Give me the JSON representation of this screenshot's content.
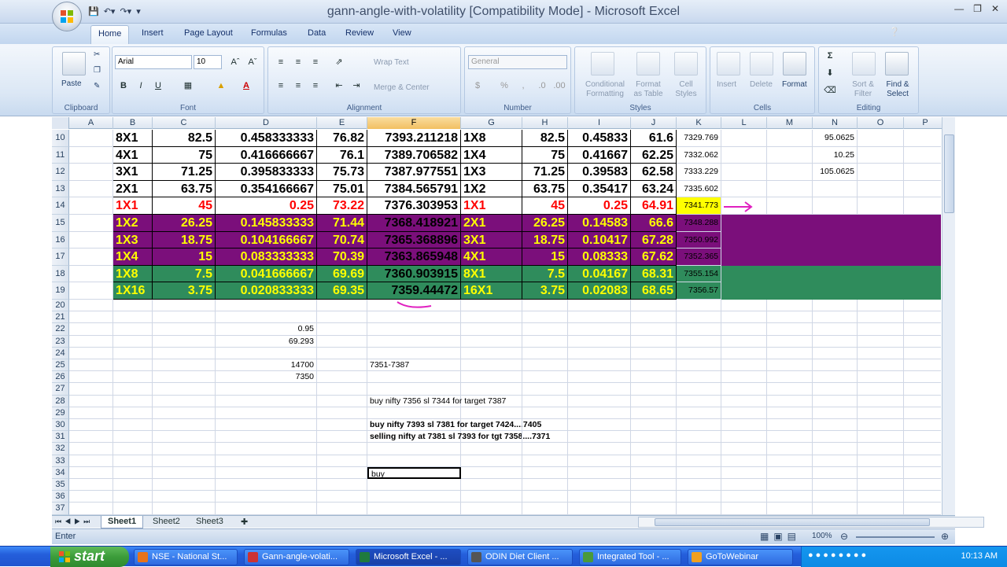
{
  "window": {
    "title": "gann-angle-with-volatility  [Compatibility Mode] - Microsoft Excel"
  },
  "menu": {
    "tabs": [
      "Home",
      "Insert",
      "Page Layout",
      "Formulas",
      "Data",
      "Review",
      "View"
    ]
  },
  "ribbon": {
    "clipboard": {
      "label": "Clipboard",
      "paste": "Paste"
    },
    "font": {
      "label": "Font",
      "name": "Arial",
      "size": "10"
    },
    "alignment": {
      "label": "Alignment",
      "wrap_text": "Wrap Text",
      "merge_center": "Merge & Center"
    },
    "number": {
      "label": "Number",
      "format": "General"
    },
    "styles": {
      "label": "Styles",
      "conditional": "Conditional\nFormatting",
      "format_table": "Format\nas Table",
      "cell_styles": "Cell\nStyles"
    },
    "cells": {
      "label": "Cells",
      "insert": "Insert",
      "delete": "Delete",
      "format": "Format"
    },
    "editing": {
      "label": "Editing",
      "sort": "Sort &\nFilter",
      "find": "Find &\nSelect"
    }
  },
  "columns": [
    "A",
    "B",
    "C",
    "D",
    "E",
    "F",
    "G",
    "H",
    "I",
    "J",
    "K",
    "L",
    "M",
    "N",
    "O",
    "P"
  ],
  "rows": [
    {
      "n": "10",
      "cells": {
        "B": "8X1",
        "C": "82.5",
        "D": "0.458333333",
        "E": "76.82",
        "F": "7393.211218",
        "G": "1X8",
        "H": "82.5",
        "I": "0.45833",
        "J": "61.6",
        "K": "7329.769",
        "N": "95.0625"
      }
    },
    {
      "n": "11",
      "cells": {
        "B": "4X1",
        "C": "75",
        "D": "0.416666667",
        "E": "76.1",
        "F": "7389.706582",
        "G": "1X4",
        "H": "75",
        "I": "0.41667",
        "J": "62.25",
        "K": "7332.062",
        "N": "10.25"
      }
    },
    {
      "n": "12",
      "cells": {
        "B": "3X1",
        "C": "71.25",
        "D": "0.395833333",
        "E": "75.73",
        "F": "7387.977551",
        "G": "1X3",
        "H": "71.25",
        "I": "0.39583",
        "J": "62.58",
        "K": "7333.229",
        "N": "105.0625"
      }
    },
    {
      "n": "13",
      "cells": {
        "B": "2X1",
        "C": "63.75",
        "D": "0.354166667",
        "E": "75.01",
        "F": "7384.565791",
        "G": "1X2",
        "H": "63.75",
        "I": "0.35417",
        "J": "63.24",
        "K": "7335.602"
      }
    },
    {
      "n": "14",
      "cells": {
        "B": "1X1",
        "C": "45",
        "D": "0.25",
        "E": "73.22",
        "F": "7376.303953",
        "G": "1X1",
        "H": "45",
        "I": "0.25",
        "J": "64.91",
        "K": "7341.773"
      }
    },
    {
      "n": "15",
      "cells": {
        "B": "1X2",
        "C": "26.25",
        "D": "0.145833333",
        "E": "71.44",
        "F": "7368.418921",
        "G": "2X1",
        "H": "26.25",
        "I": "0.14583",
        "J": "66.6",
        "K": "7348.288"
      }
    },
    {
      "n": "16",
      "cells": {
        "B": "1X3",
        "C": "18.75",
        "D": "0.104166667",
        "E": "70.74",
        "F": "7365.368896",
        "G": "3X1",
        "H": "18.75",
        "I": "0.10417",
        "J": "67.28",
        "K": "7350.992"
      }
    },
    {
      "n": "17",
      "cells": {
        "B": "1X4",
        "C": "15",
        "D": "0.083333333",
        "E": "70.39",
        "F": "7363.865948",
        "G": "4X1",
        "H": "15",
        "I": "0.08333",
        "J": "67.62",
        "K": "7352.365"
      }
    },
    {
      "n": "18",
      "cells": {
        "B": "1X8",
        "C": "7.5",
        "D": "0.041666667",
        "E": "69.69",
        "F": "7360.903915",
        "G": "8X1",
        "H": "7.5",
        "I": "0.04167",
        "J": "68.31",
        "K": "7355.154"
      }
    },
    {
      "n": "19",
      "cells": {
        "B": "1X16",
        "C": "3.75",
        "D": "0.020833333",
        "E": "69.35",
        "F": "7359.44472",
        "G": "16X1",
        "H": "3.75",
        "I": "0.02083",
        "J": "68.65",
        "K": "7356.57"
      }
    },
    {
      "n": "20",
      "cells": {}
    },
    {
      "n": "21",
      "cells": {}
    },
    {
      "n": "22",
      "cells": {
        "D": "0.95"
      }
    },
    {
      "n": "23",
      "cells": {
        "D": "69.293"
      }
    },
    {
      "n": "24",
      "cells": {}
    },
    {
      "n": "25",
      "cells": {
        "D": "14700",
        "F": "7351-7387"
      }
    },
    {
      "n": "26",
      "cells": {
        "D": "7350"
      }
    },
    {
      "n": "27",
      "cells": {}
    },
    {
      "n": "28",
      "cells": {
        "F": "buy nifty 7356 sl 7344 for target 7387"
      }
    },
    {
      "n": "29",
      "cells": {}
    },
    {
      "n": "30",
      "cells": {
        "F": "buy nifty 7393 sl 7381 for target 7424....7405"
      }
    },
    {
      "n": "31",
      "cells": {
        "F": "selling nifty at 7381 sl 7393 for tgt 7358....7371"
      }
    },
    {
      "n": "32",
      "cells": {}
    },
    {
      "n": "33",
      "cells": {}
    },
    {
      "n": "34",
      "cells": {
        "F": "buy"
      }
    },
    {
      "n": "35",
      "cells": {}
    },
    {
      "n": "36",
      "cells": {}
    },
    {
      "n": "37",
      "cells": {}
    }
  ],
  "sheets": [
    "Sheet1",
    "Sheet2",
    "Sheet3"
  ],
  "status": {
    "mode": "Enter",
    "zoom": "100%"
  },
  "taskbar": {
    "start": "start",
    "items": [
      "NSE - National St...",
      "Gann-angle-volati...",
      "Microsoft Excel - ...",
      "ODIN Diet Client ...",
      "Integrated Tool - ...",
      "GoToWebinar"
    ],
    "clock": "10:13 AM"
  },
  "colors": {
    "purple": "#7b0f7b",
    "green": "#2f8c5c",
    "yellow": "#ffff00",
    "red": "#ff0000"
  }
}
